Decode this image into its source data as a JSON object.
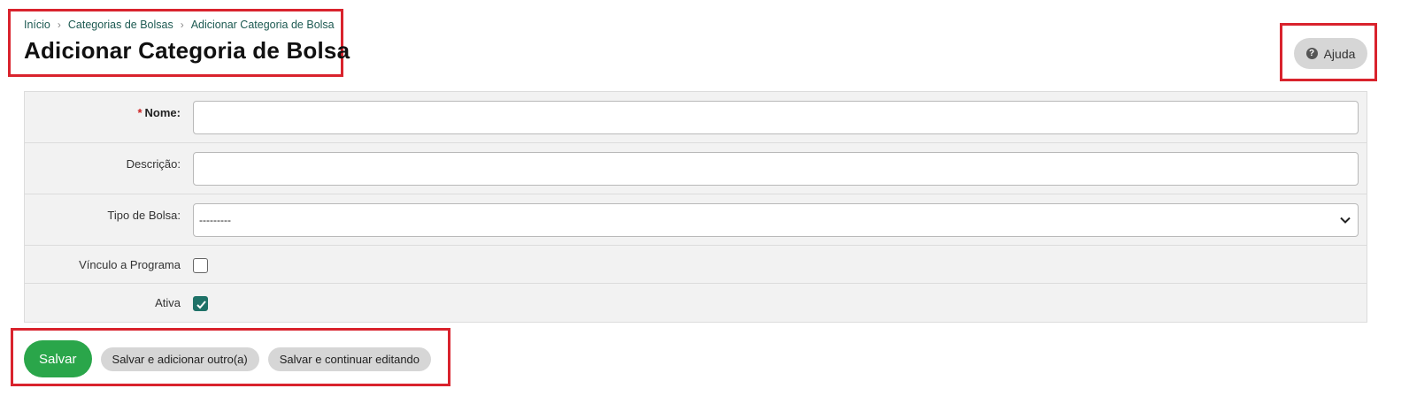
{
  "breadcrumb": {
    "items": [
      "Início",
      "Categorias de Bolsas",
      "Adicionar Categoria de Bolsa"
    ],
    "separator": "›"
  },
  "page_title": "Adicionar Categoria de Bolsa",
  "help_button": {
    "label": "Ajuda",
    "icon": "question-circle-icon"
  },
  "form": {
    "fields": [
      {
        "label": "Nome:",
        "required": true,
        "value": ""
      },
      {
        "label": "Descrição:",
        "required": false,
        "value": ""
      },
      {
        "label": "Tipo de Bolsa:",
        "selected": "---------"
      },
      {
        "label": "Vínculo a Programa",
        "checked": false
      },
      {
        "label": "Ativa",
        "checked": true
      }
    ],
    "required_marker": "*"
  },
  "actions": {
    "save": "Salvar",
    "save_add_another": "Salvar e adicionar outro(a)",
    "save_continue": "Salvar e continuar editando"
  },
  "colors": {
    "accent_green": "#2aa64a",
    "checkbox_teal": "#1f7268",
    "link": "#1d5a52",
    "highlight_red": "#d9232d"
  }
}
